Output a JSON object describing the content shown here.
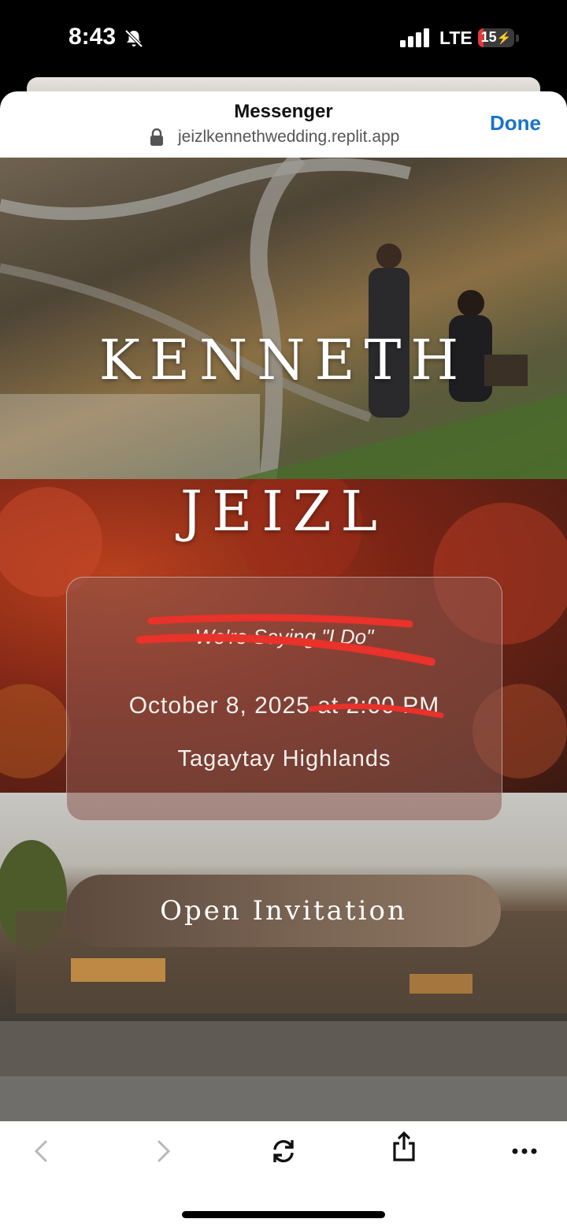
{
  "status_bar": {
    "time": "8:43",
    "network": "LTE",
    "battery_level": "15",
    "battery_color": "#e53935"
  },
  "browser": {
    "title": "Messenger",
    "url": "jeizlkennethwedding.replit.app",
    "done_label": "Done",
    "accent_color": "#1a73c7"
  },
  "page": {
    "name_1": "KENNETH",
    "name_2": "JEIZL",
    "tagline": "We're Saying \"I Do\"",
    "date": "October 8, 2025 at 2:00 PM",
    "venue": "Tagaytay Highlands",
    "button_label": "Open Invitation"
  },
  "toolbar": {
    "items": [
      "back-icon",
      "forward-icon",
      "reload-icon",
      "share-icon",
      "more-icon"
    ]
  }
}
